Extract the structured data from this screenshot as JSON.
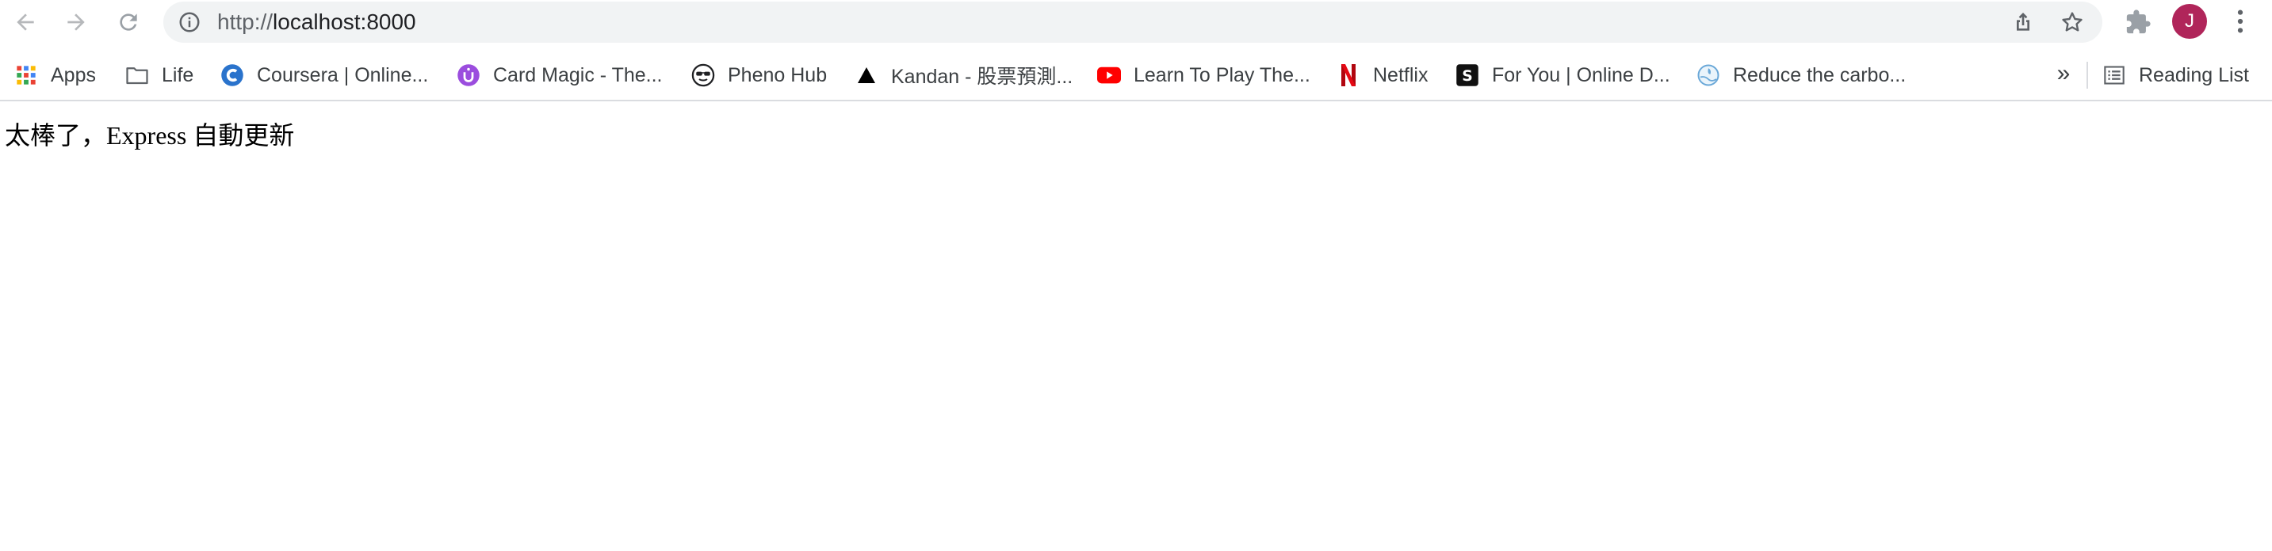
{
  "toolbar": {
    "back_icon": "arrow-left-icon",
    "forward_icon": "arrow-right-icon",
    "reload_icon": "reload-icon",
    "url_scheme": "http://",
    "url_host": "localhost:8000",
    "avatar_letter": "J",
    "avatar_color": "#b0255a"
  },
  "bookmarks": [
    {
      "label": "Apps",
      "icon": "apps-grid-icon"
    },
    {
      "label": "Life",
      "icon": "folder-icon"
    },
    {
      "label": "Coursera | Online...",
      "icon": "coursera-icon"
    },
    {
      "label": "Card Magic - The...",
      "icon": "card-magic-icon"
    },
    {
      "label": "Pheno Hub",
      "icon": "sunglasses-face-icon"
    },
    {
      "label": "Kandan - 股票預測...",
      "icon": "triangle-icon"
    },
    {
      "label": "Learn To Play The...",
      "icon": "youtube-icon"
    },
    {
      "label": "Netflix",
      "icon": "netflix-icon"
    },
    {
      "label": "For You | Online D...",
      "icon": "skillshare-icon"
    },
    {
      "label": "Reduce the carbo...",
      "icon": "globe-leaf-icon"
    }
  ],
  "overflow_label": "»",
  "reading_list_label": "Reading List",
  "page": {
    "text": "太棒了，Express 自動更新"
  }
}
